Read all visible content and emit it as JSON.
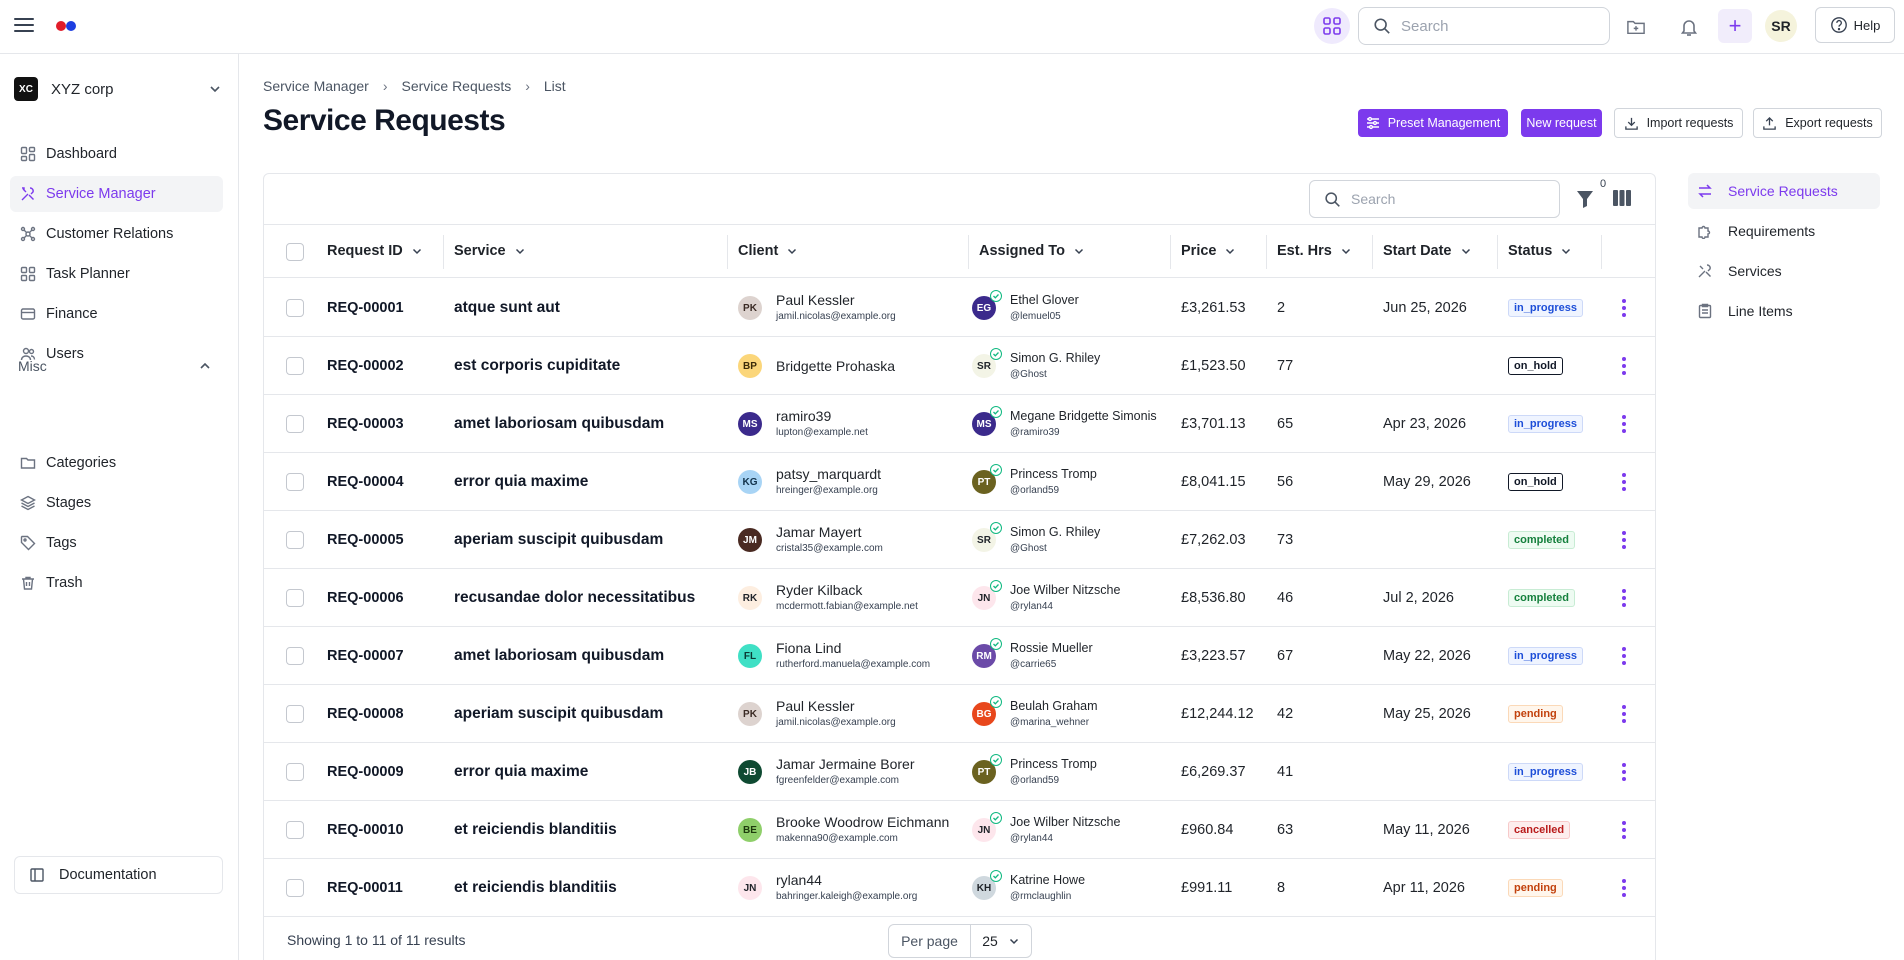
{
  "topbar": {
    "search_placeholder": "Search",
    "avatar_initials": "SR",
    "help_label": "Help",
    "plus_label": "+"
  },
  "sidebar": {
    "org_badge": "XC",
    "org_name": "XYZ corp",
    "items": [
      {
        "label": "Dashboard",
        "icon": "dashboard-icon"
      },
      {
        "label": "Service Manager",
        "icon": "tools-icon"
      },
      {
        "label": "Customer Relations",
        "icon": "network-icon"
      },
      {
        "label": "Task Planner",
        "icon": "grid-icon"
      },
      {
        "label": "Finance",
        "icon": "card-icon"
      },
      {
        "label": "Users",
        "icon": "users-icon"
      }
    ],
    "misc_label": "Misc",
    "misc_items": [
      {
        "label": "Categories",
        "icon": "folder-icon"
      },
      {
        "label": "Stages",
        "icon": "layers-icon"
      },
      {
        "label": "Tags",
        "icon": "tag-icon"
      },
      {
        "label": "Trash",
        "icon": "trash-icon"
      }
    ],
    "documentation_label": "Documentation"
  },
  "breadcrumb": [
    "Service Manager",
    "Service Requests",
    "List"
  ],
  "page_title": "Service Requests",
  "actions": {
    "preset": "Preset Management",
    "new_request": "New request",
    "import": "Import requests",
    "export": "Export requests"
  },
  "table": {
    "search_placeholder": "Search",
    "filter_count": "0",
    "columns": [
      "Request ID",
      "Service",
      "Client",
      "Assigned To",
      "Price",
      "Est. Hrs",
      "Start Date",
      "Status"
    ],
    "rows": [
      {
        "id": "REQ-00001",
        "service": "atque sunt aut",
        "client": {
          "initials": "PK",
          "name": "Paul Kessler",
          "email": "jamil.nicolas@example.org",
          "color": "#ddd3cf",
          "text": "#3a2a24"
        },
        "assigned": {
          "initials": "EG",
          "name": "Ethel Glover",
          "handle": "@lemuel05",
          "color": "#3b2a8c",
          "text": "#ffffff"
        },
        "price": "£3,261.53",
        "hrs": "2",
        "date": "Jun 25, 2026",
        "status": "in_progress"
      },
      {
        "id": "REQ-00002",
        "service": "est corporis cupiditate",
        "client": {
          "initials": "BP",
          "name": "Bridgette Prohaska",
          "email": "",
          "color": "#fbd67a",
          "text": "#3a2a08"
        },
        "assigned": {
          "initials": "SR",
          "name": "Simon G. Rhiley",
          "handle": "@Ghost",
          "color": "#f3f4e6",
          "text": "#1f2329"
        },
        "price": "£1,523.50",
        "hrs": "77",
        "date": "",
        "status": "on_hold"
      },
      {
        "id": "REQ-00003",
        "service": "amet laboriosam quibusdam",
        "client": {
          "initials": "MS",
          "name": "ramiro39",
          "email": "lupton@example.net",
          "color": "#3b2a8c",
          "text": "#ffffff"
        },
        "assigned": {
          "initials": "MS",
          "name": "Megane Bridgette Simonis",
          "handle": "@ramiro39",
          "color": "#3b2a8c",
          "text": "#ffffff"
        },
        "price": "£3,701.13",
        "hrs": "65",
        "date": "Apr 23, 2026",
        "status": "in_progress"
      },
      {
        "id": "REQ-00004",
        "service": "error quia maxime",
        "client": {
          "initials": "KG",
          "name": "patsy_marquardt",
          "email": "hreinger@example.org",
          "color": "#a8d4f5",
          "text": "#12324a"
        },
        "assigned": {
          "initials": "PT",
          "name": "Princess Tromp",
          "handle": "@orland59",
          "color": "#6b6220",
          "text": "#ffffff"
        },
        "price": "£8,041.15",
        "hrs": "56",
        "date": "May 29, 2026",
        "status": "on_hold"
      },
      {
        "id": "REQ-00005",
        "service": "aperiam suscipit quibusdam",
        "client": {
          "initials": "JM",
          "name": "Jamar Mayert",
          "email": "cristal35@example.com",
          "color": "#4a2a22",
          "text": "#ffffff"
        },
        "assigned": {
          "initials": "SR",
          "name": "Simon G. Rhiley",
          "handle": "@Ghost",
          "color": "#f3f4e6",
          "text": "#1f2329"
        },
        "price": "£7,262.03",
        "hrs": "73",
        "date": "",
        "status": "completed"
      },
      {
        "id": "REQ-00006",
        "service": "recusandae dolor necessitatibus",
        "client": {
          "initials": "RK",
          "name": "Ryder Kilback",
          "email": "mcdermott.fabian@example.net",
          "color": "#fdeee0",
          "text": "#1f2329"
        },
        "assigned": {
          "initials": "JN",
          "name": "Joe Wilber Nitzsche",
          "handle": "@rylan44",
          "color": "#fde6ec",
          "text": "#1f2329"
        },
        "price": "£8,536.80",
        "hrs": "46",
        "date": "Jul 2, 2026",
        "status": "completed"
      },
      {
        "id": "REQ-00007",
        "service": "amet laboriosam quibusdam",
        "client": {
          "initials": "FL",
          "name": "Fiona Lind",
          "email": "rutherford.manuela@example.com",
          "color": "#3fe0c5",
          "text": "#0a3a33"
        },
        "assigned": {
          "initials": "RM",
          "name": "Rossie Mueller",
          "handle": "@carrie65",
          "color": "#6b4aa8",
          "text": "#ffffff"
        },
        "price": "£3,223.57",
        "hrs": "67",
        "date": "May 22, 2026",
        "status": "in_progress"
      },
      {
        "id": "REQ-00008",
        "service": "aperiam suscipit quibusdam",
        "client": {
          "initials": "PK",
          "name": "Paul Kessler",
          "email": "jamil.nicolas@example.org",
          "color": "#ddd3cf",
          "text": "#3a2a24"
        },
        "assigned": {
          "initials": "BG",
          "name": "Beulah Graham",
          "handle": "@marina_wehner",
          "color": "#e8471c",
          "text": "#ffffff"
        },
        "price": "£12,244.12",
        "hrs": "42",
        "date": "May 25, 2026",
        "status": "pending"
      },
      {
        "id": "REQ-00009",
        "service": "error quia maxime",
        "client": {
          "initials": "JB",
          "name": "Jamar Jermaine Borer",
          "email": "fgreenfelder@example.com",
          "color": "#0f4a32",
          "text": "#ffffff"
        },
        "assigned": {
          "initials": "PT",
          "name": "Princess Tromp",
          "handle": "@orland59",
          "color": "#6b6220",
          "text": "#ffffff"
        },
        "price": "£6,269.37",
        "hrs": "41",
        "date": "",
        "status": "in_progress"
      },
      {
        "id": "REQ-00010",
        "service": "et reiciendis blanditiis",
        "client": {
          "initials": "BE",
          "name": "Brooke Woodrow Eichmann",
          "email": "makenna90@example.com",
          "color": "#8fcf6a",
          "text": "#1d3a0c"
        },
        "assigned": {
          "initials": "JN",
          "name": "Joe Wilber Nitzsche",
          "handle": "@rylan44",
          "color": "#fde6ec",
          "text": "#1f2329"
        },
        "price": "£960.84",
        "hrs": "63",
        "date": "May 11, 2026",
        "status": "cancelled"
      },
      {
        "id": "REQ-00011",
        "service": "et reiciendis blanditiis",
        "client": {
          "initials": "JN",
          "name": "rylan44",
          "email": "bahringer.kaleigh@example.org",
          "color": "#fde6ec",
          "text": "#1f2329"
        },
        "assigned": {
          "initials": "KH",
          "name": "Katrine Howe",
          "handle": "@rmclaughlin",
          "color": "#cfd8de",
          "text": "#1f2329"
        },
        "price": "£991.11",
        "hrs": "8",
        "date": "Apr 11, 2026",
        "status": "pending"
      }
    ]
  },
  "footer": {
    "showing": "Showing 1 to 11 of 11 results",
    "per_page_label": "Per page",
    "per_page_value": "25"
  },
  "right_nav": [
    {
      "label": "Service Requests",
      "icon": "swap-icon"
    },
    {
      "label": "Requirements",
      "icon": "puzzle-icon"
    },
    {
      "label": "Services",
      "icon": "tools-icon"
    },
    {
      "label": "Line Items",
      "icon": "clipboard-icon"
    }
  ],
  "colors": {
    "accent": "#7c3aed",
    "sidebar_active_bg": "#f3f4f6"
  }
}
